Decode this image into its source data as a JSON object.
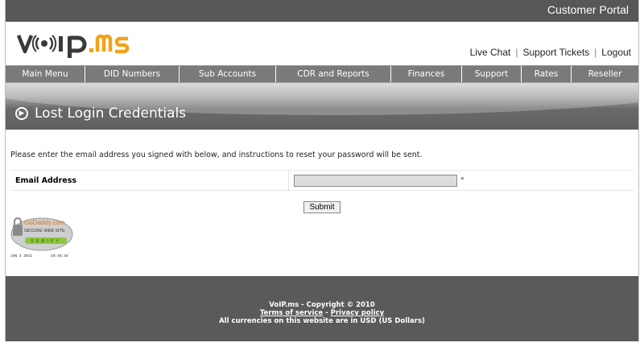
{
  "topbar": {
    "portal": "Customer Portal"
  },
  "header": {
    "logo_text": "voip.ms",
    "links": [
      "Live Chat",
      "Support Tickets",
      "Logout"
    ]
  },
  "nav": [
    "Main Menu",
    "DID Numbers",
    "Sub Accounts",
    "CDR and Reports",
    "Finances",
    "Support",
    "Rates",
    "Reseller"
  ],
  "banner": {
    "title": "Lost Login Credentials"
  },
  "content": {
    "intro": "Please enter the email address you signed with below, and instructions to reset your password will be sent.",
    "email_label": "Email Address",
    "email_value": "",
    "required_mark": "*",
    "submit_label": "Submit"
  },
  "seal": {
    "brand": "GoDaddy.com",
    "line": "SECURE WEB SITE",
    "verify": "VERIFY",
    "date": "JUN  3 2011",
    "time": "19:45:34"
  },
  "footer": {
    "copyright": "VoIP.ms - Copyright © 2010",
    "terms": "Terms of service",
    "dash": " - ",
    "privacy": "Privacy policy",
    "currency": "All currencies on this website are in USD (US Dollars)"
  },
  "colors": {
    "topbar": "#575757",
    "nav": "#7a7a7a",
    "footer": "#5a5a5a",
    "logo_accent": "#f2a21a"
  }
}
